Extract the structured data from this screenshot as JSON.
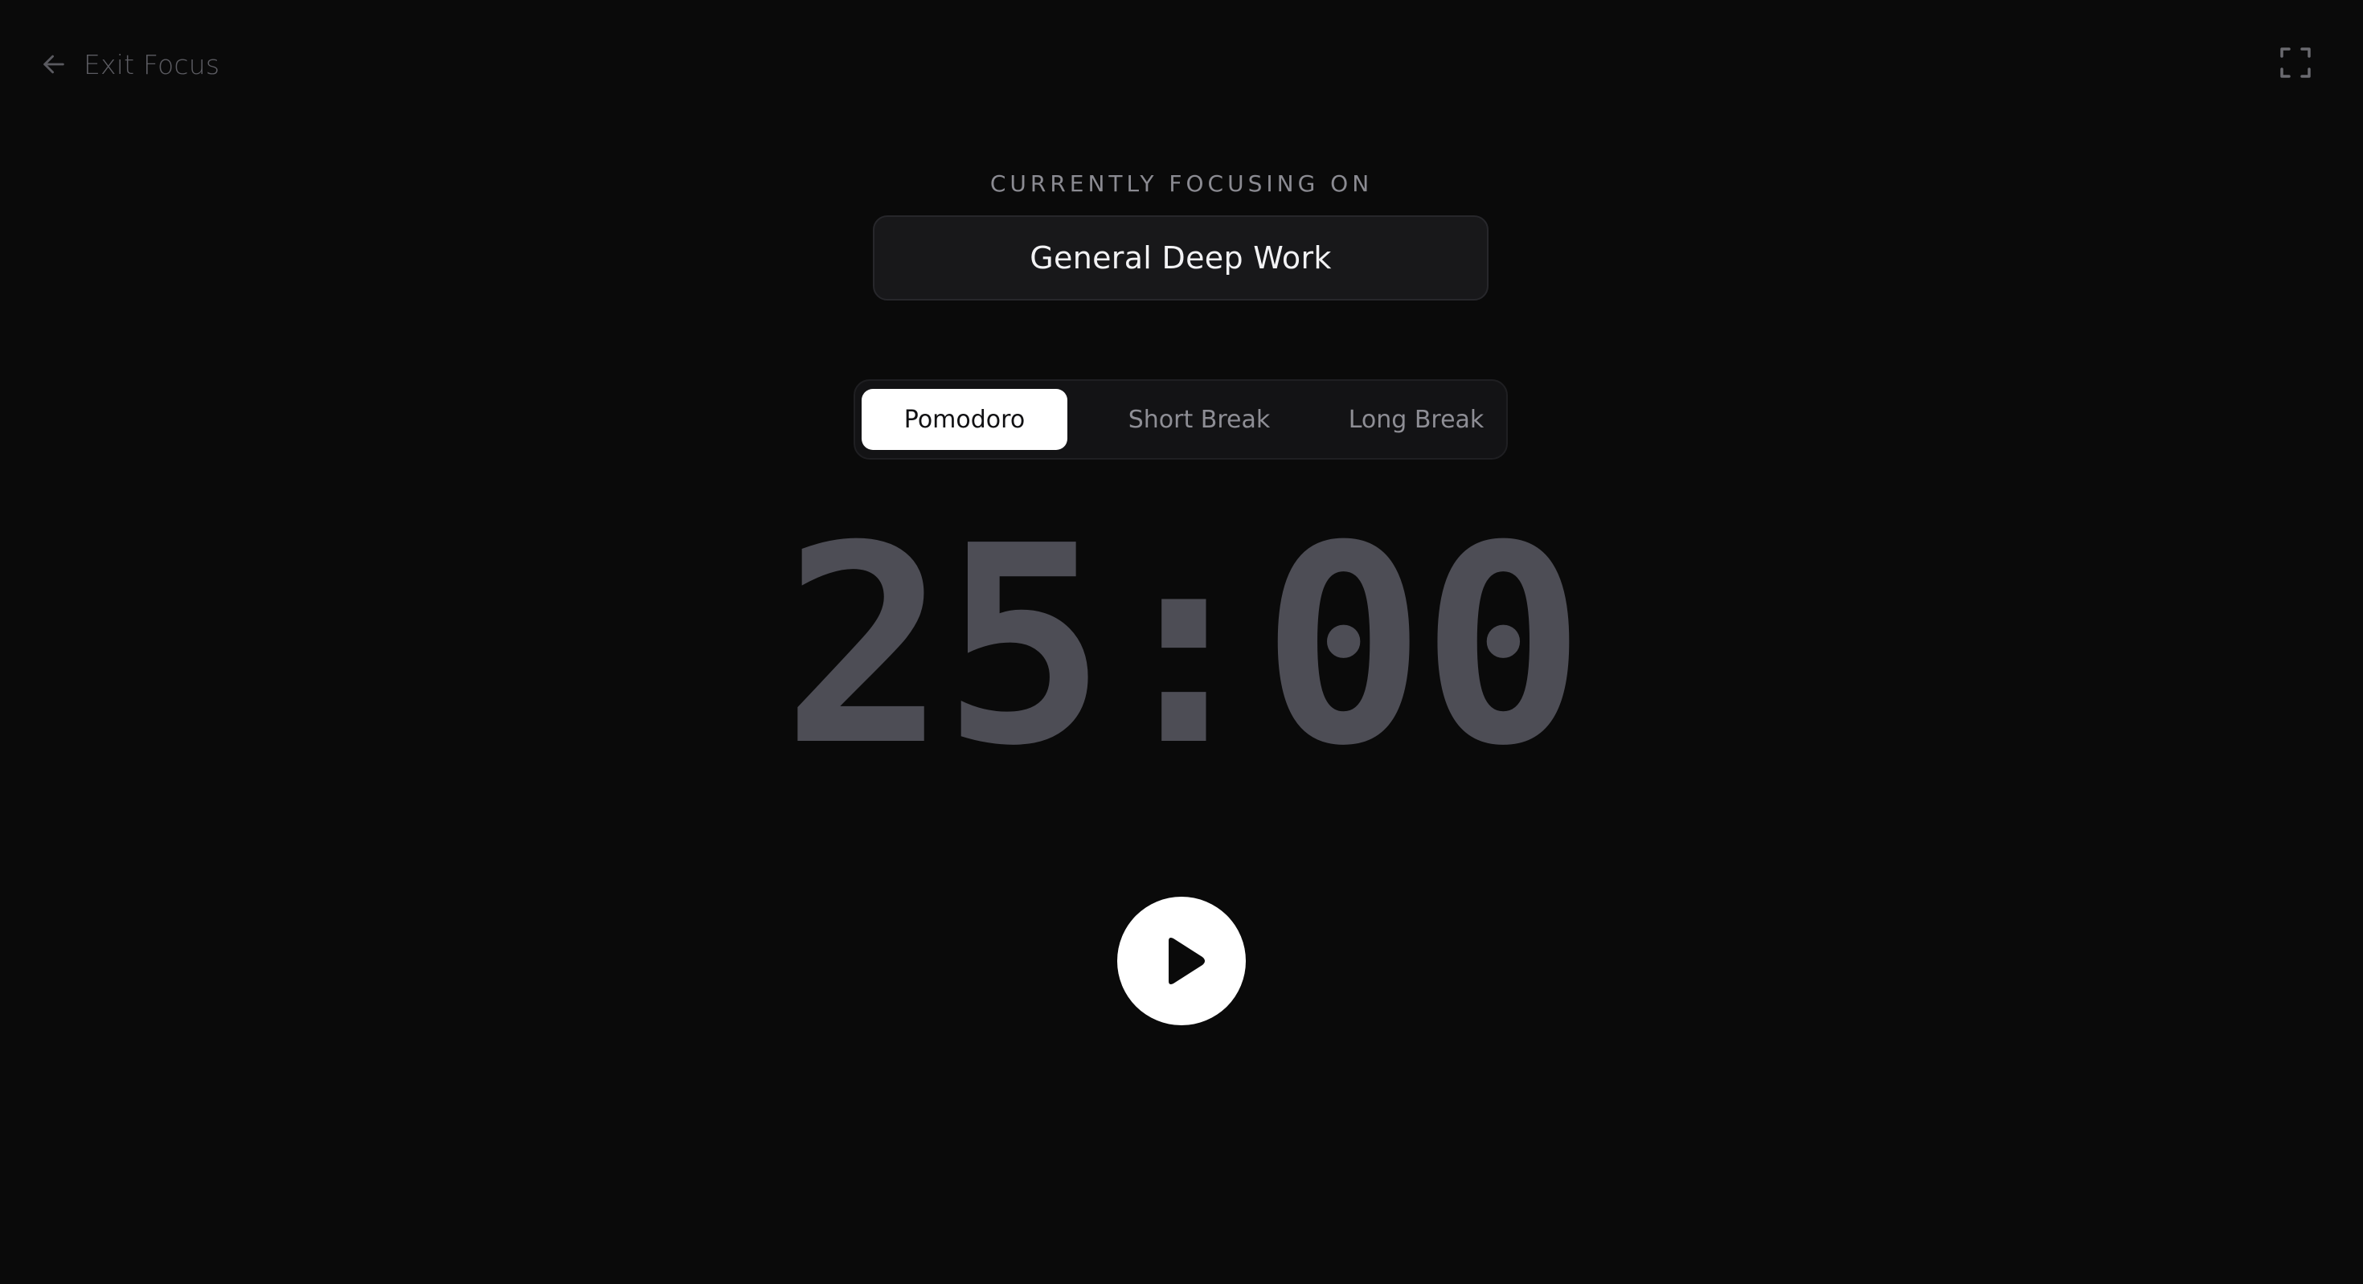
{
  "header": {
    "exit_label": "Exit Focus",
    "exit_icon": "arrow-left-icon",
    "fullscreen_icon": "fullscreen-icon"
  },
  "focus": {
    "label": "CURRENTLY FOCUSING ON",
    "task": "General Deep Work"
  },
  "modes": {
    "items": [
      {
        "label": "Pomodoro",
        "active": true
      },
      {
        "label": "Short Break",
        "active": false
      },
      {
        "label": "Long Break",
        "active": false
      }
    ]
  },
  "timer": {
    "display": "25:00"
  },
  "controls": {
    "play_icon": "play-icon"
  },
  "colors": {
    "background": "#0a0a0a",
    "timer_text": "#4d4d55",
    "active_tab_bg": "#ffffff",
    "muted_text": "#8e8e95"
  }
}
